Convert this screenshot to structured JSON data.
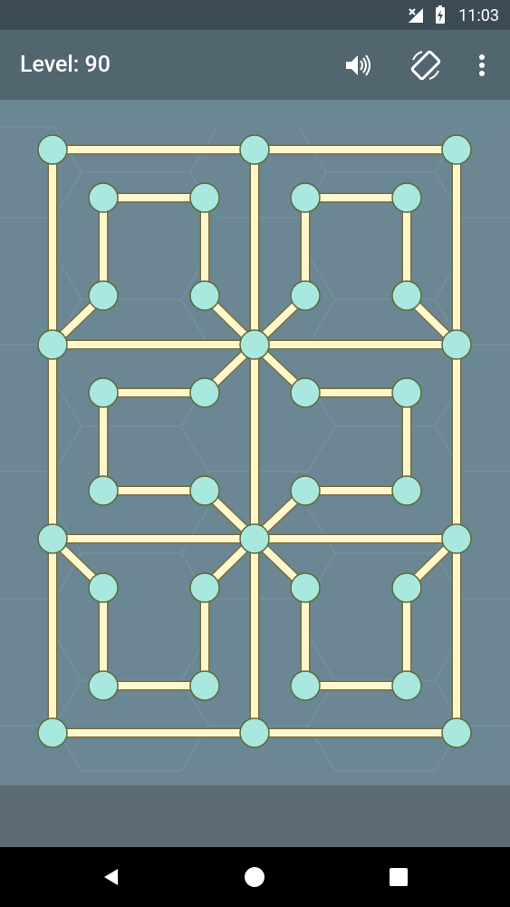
{
  "status_bar": {
    "time": "11:03",
    "icons": [
      "signal-off-icon",
      "battery-charging-icon"
    ]
  },
  "app_bar": {
    "title": "Level: 90",
    "actions": [
      "sound-icon",
      "rotate-icon",
      "more-vert-icon"
    ]
  },
  "game": {
    "node_color": "#a8e8de",
    "edge_color": "#fff8cc",
    "edge_outline": "#7c6b3e",
    "background": "#6b8793"
  },
  "nav": {
    "buttons": [
      "back-icon",
      "home-icon",
      "recents-icon"
    ]
  }
}
